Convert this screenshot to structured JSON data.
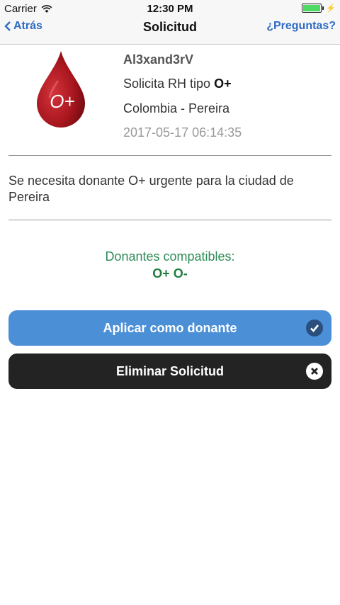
{
  "status_bar": {
    "carrier": "Carrier",
    "time": "12:30 PM"
  },
  "nav": {
    "back_label": "Atrás",
    "title": "Solicitud",
    "help_label": "¿Preguntas?"
  },
  "request": {
    "blood_type_badge": "O+",
    "user_name": "Al3xand3rV",
    "rh_prefix": "Solicita RH tipo",
    "rh_type": "O+",
    "location": "Colombia - Pereira",
    "timestamp": "2017-05-17 06:14:35",
    "description": "Se necesita donante O+ urgente para la ciudad de Pereira"
  },
  "compatibility": {
    "label": "Donantes compatibles:",
    "types": "O+ O-"
  },
  "actions": {
    "apply_label": "Aplicar como donante",
    "delete_label": "Eliminar Solicitud"
  },
  "colors": {
    "accent": "#2f6cc4",
    "apply_button": "#4b8fd6",
    "delete_button": "#232323",
    "compat_green": "#2e8b57",
    "drop_red": "#a8161e"
  },
  "icons": {
    "apply": "check-circle-icon",
    "delete": "close-circle-icon",
    "back": "chevron-left-icon",
    "wifi": "wifi-icon",
    "battery": "battery-icon"
  }
}
